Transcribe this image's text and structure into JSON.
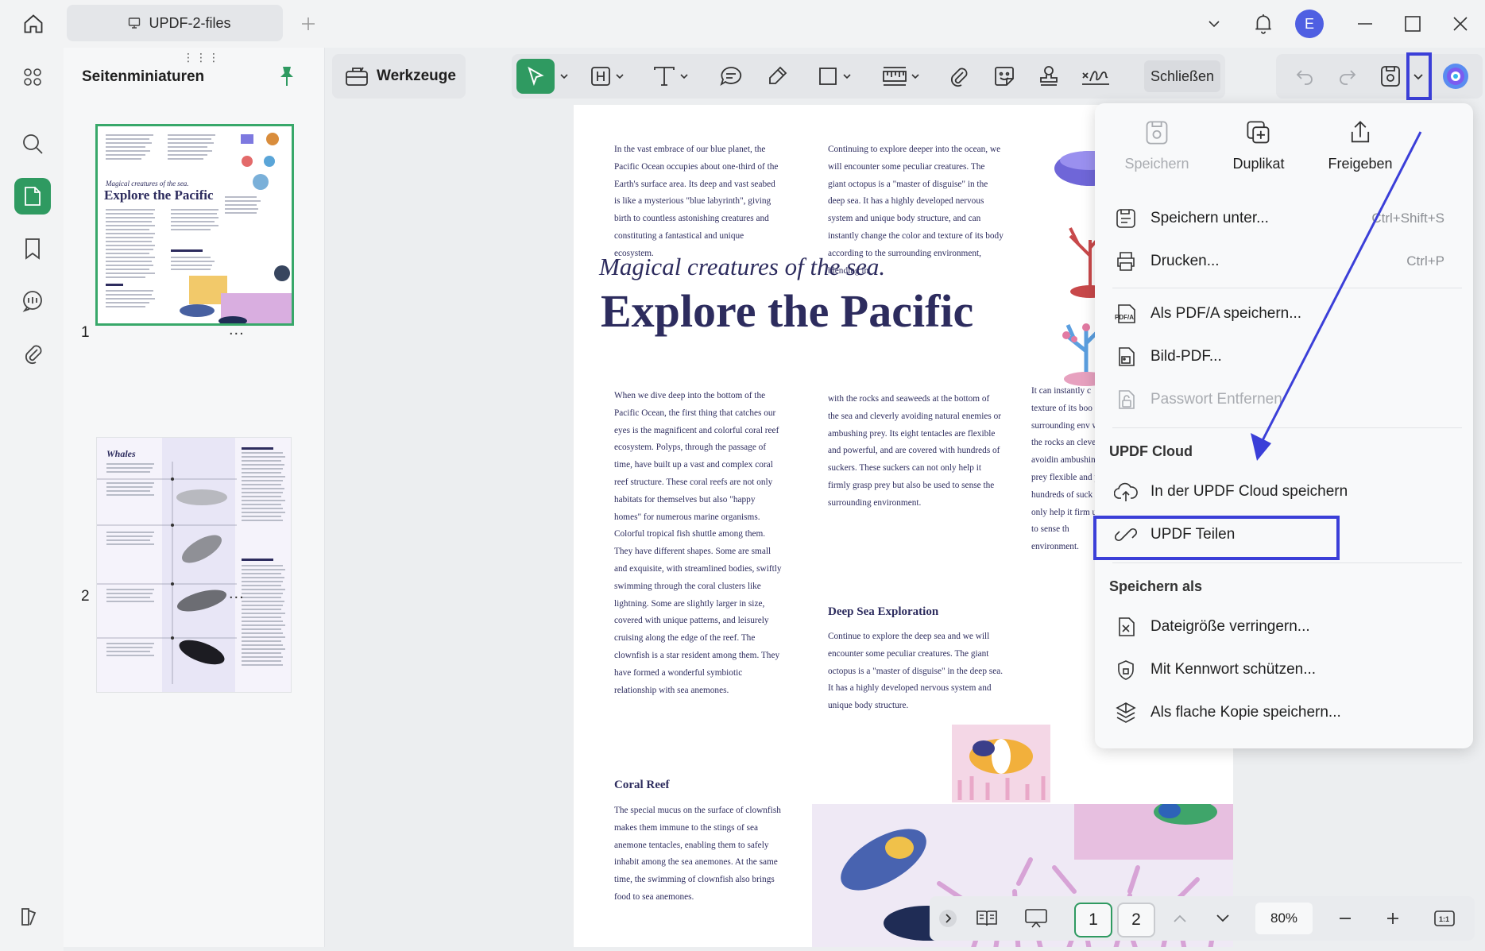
{
  "titlebar": {
    "tab_title": "UPDF-2-files",
    "avatar_initial": "E"
  },
  "thumbnails": {
    "title": "Seitenminiaturen",
    "pages": [
      {
        "number": "1",
        "more": "..."
      },
      {
        "number": "2",
        "more": "..."
      }
    ],
    "page1_heading_small": "Magical creatures of the sea.",
    "page1_heading_big": "Explore the Pacific",
    "page2_heading": "Whales"
  },
  "toolbar": {
    "werkzeuge": "Werkzeuge",
    "schliessen": "Schließen"
  },
  "document": {
    "p1": "In the vast embrace of our blue planet, the Pacific Ocean occupies about one-third of the Earth's surface area. Its deep and vast seabed is like a mysterious \"blue labyrinth\", giving birth to countless astonishing creatures and constituting a fantastical and unique ecosystem.",
    "p2": "Continuing to explore deeper into the ocean, we will encounter some peculiar creatures. The giant octopus is a \"master of disguise\" in the deep sea. It has a highly developed nervous system and unique body structure, and can instantly change the color and texture of its body according to the surrounding environment, blending in",
    "subtitle": "Magical creatures of the sea.",
    "title": "Explore the Pacific",
    "p3": "When we dive deep into the bottom of the Pacific Ocean, the first thing that catches our eyes is the magnificent and colorful coral reef ecosystem. Polyps, through the passage of time, have built up a vast and complex coral reef structure. These coral reefs are not only habitats for themselves but also \"happy homes\" for numerous marine organisms. Colorful tropical fish shuttle among them. They have different shapes. Some are small and exquisite, with streamlined bodies, swiftly swimming through the coral clusters like lightning. Some are slightly larger in size, covered with unique patterns, and leisurely cruising along the edge of the reef. The clownfish is a star resident among them. They have formed a wonderful symbiotic relationship with sea anemones.",
    "p4": "with the rocks and seaweeds at the bottom of the sea and cleverly avoiding natural enemies or ambushing prey. Its eight tentacles are flexible and powerful, and are covered with hundreds of suckers. These suckers can not only help it firmly grasp prey but also be used to sense the surrounding environment.",
    "p5": "It can instantly c texture of its boo surrounding env with the rocks an cleverly avoidin ambushing prey flexible and pow hundreds of suck only help it firm used to sense th environment.",
    "h_deep": "Deep Sea Exploration",
    "p6": "Continue to explore the deep sea and we will encounter some peculiar creatures. The giant octopus is a \"master of disguise\" in the deep sea. It has a highly developed nervous system and unique body structure.",
    "h_coral": "Coral Reef",
    "p7": "The special mucus on the surface of clownfish makes them immune to the stings of sea anemone tentacles, enabling them to safely inhabit among the sea anemones. At the same time, the swimming of clownfish also brings food to sea anemones."
  },
  "menu": {
    "top": [
      {
        "label": "Speichern",
        "disabled": true
      },
      {
        "label": "Duplikat"
      },
      {
        "label": "Freigeben"
      }
    ],
    "save_as_item": {
      "label": "Speichern unter...",
      "shortcut": "Ctrl+Shift+S"
    },
    "print_item": {
      "label": "Drucken...",
      "shortcut": "Ctrl+P"
    },
    "pdfa_item": {
      "label": "Als PDF/A speichern..."
    },
    "image_pdf_item": {
      "label": "Bild-PDF..."
    },
    "remove_password_item": {
      "label": "Passwort Entfernen"
    },
    "cloud_section": "UPDF Cloud",
    "cloud_save_item": {
      "label": "In der UPDF Cloud speichern"
    },
    "share_item": {
      "label": "UPDF Teilen"
    },
    "save_as_section": "Speichern als",
    "reduce_item": {
      "label": "Dateigröße verringern..."
    },
    "protect_item": {
      "label": "Mit Kennwort schützen..."
    },
    "flatten_item": {
      "label": "Als flache Kopie speichern..."
    }
  },
  "bottombar": {
    "page1": "1",
    "page2": "2",
    "zoom": "80%"
  },
  "colors": {
    "accent_green": "#2f9a61",
    "annotation_blue": "#3b3fd8",
    "avatar": "#4f5fe2",
    "doc_navy": "#2d2c5e"
  }
}
